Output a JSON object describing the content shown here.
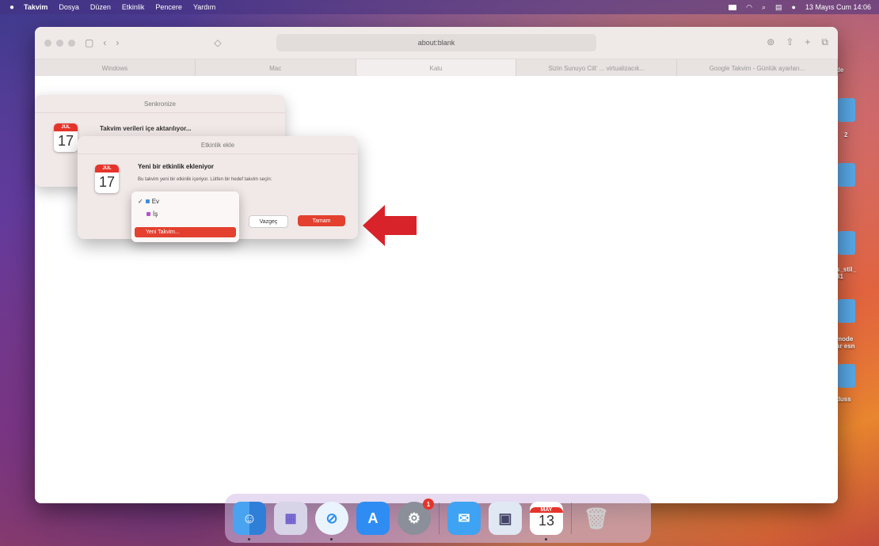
{
  "menubar": {
    "apple": "",
    "items": [
      "Takvim",
      "Dosya",
      "Düzen",
      "Etkinlik",
      "Pencere",
      "Yardım"
    ],
    "datetime": "13 Mayıs Cum 14:06"
  },
  "safari": {
    "url": "about:blank",
    "tabs": [
      "Windows",
      "Mac",
      "Kalu",
      "Sizin Sunuyo Cilt' ... virtualizacık...",
      "Google Takvim - Günlük ayarları..."
    ],
    "active_tab": 2
  },
  "dialog_back": {
    "title": "Senkronize",
    "message": "Takvim verileri içe aktarılıyor...",
    "cal_month": "JUL",
    "cal_day": "17"
  },
  "dialog_front": {
    "title": "Etkinlik ekle",
    "heading": "Yeni bir etkinlik ekleniyor",
    "description": "Bu takvim yeni bir etkinlik içeriyor. Lütfen bir hedef takvim seçin:",
    "cal_month": "JUL",
    "cal_day": "17",
    "cancel_label": "Vazgeç",
    "ok_label": "Tamam"
  },
  "calendar_popup": {
    "options": [
      {
        "label": "Ev",
        "color": "#3a8fd9",
        "checked": true
      },
      {
        "label": "İş",
        "color": "#b64fd0",
        "checked": false
      }
    ],
    "new_calendar_label": "Yeni Takvim..."
  },
  "desktop": {
    "labels": [
      "de",
      "2",
      "s_stil_\n31",
      "mode\nar esn",
      "duss"
    ]
  },
  "dock": {
    "apps": [
      "Finder",
      "Launchpad",
      "Safari",
      "App Store",
      "System Preferences",
      "Mail",
      "Preview",
      "Calendar",
      "Trash"
    ],
    "calendar_month": "MAY",
    "calendar_day": "13",
    "syspref_badge": "1"
  },
  "colors": {
    "accent_red": "#e3402f",
    "arrow_red": "#d8232a"
  }
}
